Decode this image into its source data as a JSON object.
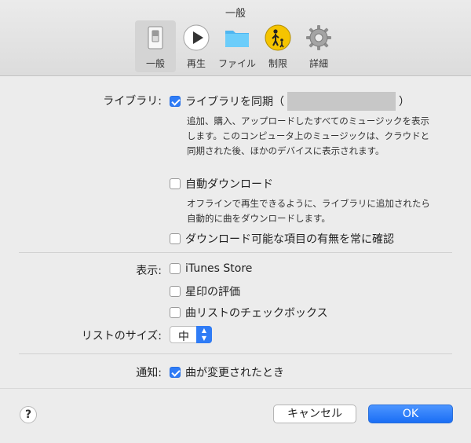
{
  "window": {
    "title": "一般"
  },
  "toolbar": {
    "items": [
      {
        "label": "一般",
        "icon": "general-switch-icon"
      },
      {
        "label": "再生",
        "icon": "play-icon"
      },
      {
        "label": "ファイル",
        "icon": "folder-icon"
      },
      {
        "label": "制限",
        "icon": "parental-restriction-icon"
      },
      {
        "label": "詳細",
        "icon": "gear-icon"
      }
    ],
    "selected": "一般"
  },
  "library": {
    "section_label": "ライブラリ:",
    "sync": {
      "label_prefix": "ライブラリを同期（",
      "label_suffix": "）",
      "checked": true
    },
    "sync_desc": "追加、購入、アップロードしたすべてのミュージックを表示します。このコンピュータ上のミュージックは、クラウドと同期された後、ほかのデバイスに表示されます。",
    "auto_download": {
      "label": "自動ダウンロード",
      "checked": false
    },
    "auto_download_desc": "オフラインで再生できるように、ライブラリに追加されたら自動的に曲をダウンロードします。",
    "always_check": {
      "label": "ダウンロード可能な項目の有無を常に確認",
      "checked": false
    }
  },
  "display": {
    "section_label": "表示:",
    "itunes_store": {
      "label": "iTunes Store",
      "checked": false
    },
    "star_rating": {
      "label": "星印の評価",
      "checked": false
    },
    "list_checkboxes": {
      "label": "曲リストのチェックボックス",
      "checked": false
    }
  },
  "list_size": {
    "label": "リストのサイズ:",
    "value": "中"
  },
  "notifications": {
    "section_label": "通知:",
    "song_change": {
      "label": "曲が変更されたとき",
      "checked": true
    }
  },
  "buttons": {
    "help": "?",
    "cancel": "キャンセル",
    "ok": "OK"
  },
  "colors": {
    "accent": "#2f7cf6",
    "window_bg": "#ececec",
    "folder": "#5ac8fa",
    "restriction": "#f5c400"
  }
}
